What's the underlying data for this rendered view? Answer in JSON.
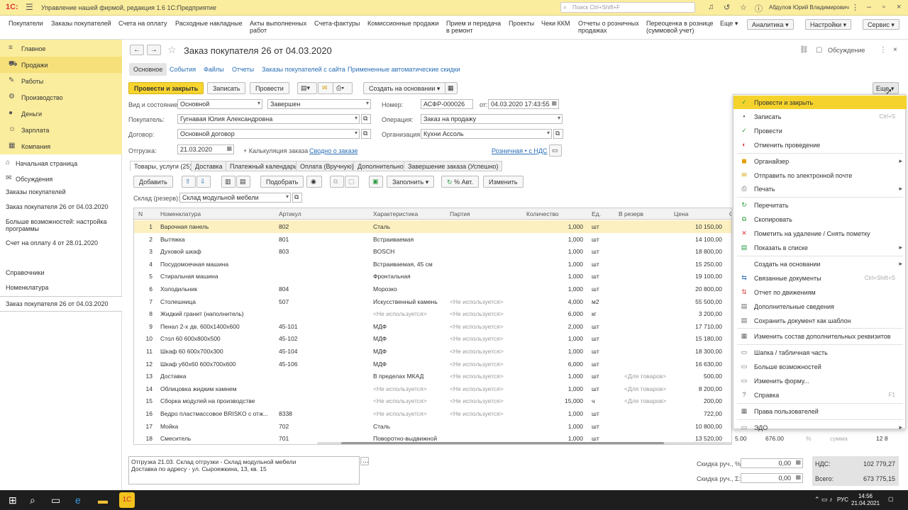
{
  "window": {
    "logo": "1С:",
    "title": "Управление нашей фирмой, редакция 1.6 1С:Предприятие",
    "search_placeholder": "Поиск Ctrl+Shift+F",
    "user": "Абдулов Юрий Владимирович"
  },
  "menubar": {
    "items": [
      "Покупатели",
      "Заказы покупателей",
      "Счета на оплату",
      "Расходные накладные",
      "Акты выполненных\nработ",
      "Счета-фактуры",
      "Комиссионные продажи",
      "Прием и передача\nв ремонт",
      "Проекты",
      "Чеки ККМ",
      "Отчеты о розничных\nпродажах",
      "Переоценка в рознице\n(суммовой учет)",
      "Еще"
    ],
    "buttons": [
      "Аналитика",
      "Настройки",
      "Сервис"
    ]
  },
  "sidebar": {
    "sections": [
      {
        "label": "Главное",
        "icon": "menu-icon"
      },
      {
        "label": "Продажи",
        "icon": "cart-icon"
      },
      {
        "label": "Работы",
        "icon": "wrench-icon"
      },
      {
        "label": "Производство",
        "icon": "factory-icon"
      },
      {
        "label": "Деньги",
        "icon": "coin-icon"
      },
      {
        "label": "Зарплата",
        "icon": "people-icon"
      },
      {
        "label": "Компания",
        "icon": "building-icon"
      }
    ],
    "nav": [
      {
        "label": "Начальная страница",
        "icon": "home-icon"
      },
      {
        "label": "Обсуждения",
        "icon": "chat-icon"
      }
    ],
    "history": [
      "Заказы покупателей",
      "Заказ покупателя 26 от 04.03.2020",
      "Больше возможностей: настройка программы",
      "Счет на оплату 4 от 28.01.2020",
      "Справочники",
      "Номенклатура",
      "Заказ покупателя 26 от 04.03.2020"
    ]
  },
  "doc": {
    "title": "Заказ покупателя 26 от 04.03.2020",
    "discussion": "Обсуждение",
    "tabs": [
      "Основное",
      "События",
      "Файлы",
      "Отчеты",
      "Заказы покупателей с сайта",
      "Примененные автоматические скидки"
    ],
    "toolbar": {
      "post_close": "Провести и закрыть",
      "save": "Записать",
      "post": "Провести",
      "create_based": "Создать на основании",
      "more": "Еще"
    },
    "fields": {
      "kind_label": "Вид и состояние:",
      "kind": "Основной",
      "state": "Завершен",
      "number_label": "Номер:",
      "number": "АСФР-000026",
      "from_label": "от:",
      "date": "04.03.2020 17:43:55",
      "buyer_label": "Покупатель:",
      "buyer": "Гугнавая Юлия Александровна",
      "operation_label": "Операция:",
      "operation": "Заказ на продажу",
      "contract_label": "Договор:",
      "contract": "Основной договор",
      "org_label": "Организация:",
      "org": "Кухни Ассоль",
      "ship_label": "Отгрузка:",
      "ship_date": "21.03.2020",
      "calc": "+ Калькуляция заказа",
      "summary": "Сводно о заказе",
      "price_type": "Розничная • с НДС"
    },
    "subtabs": [
      "Товары, услуги (25)",
      "Доставка",
      "Платежный календарь",
      "Оплата (Вручную)",
      "Дополнительно",
      "Завершение заказа (Успешно)"
    ],
    "tabletools": {
      "add": "Добавить",
      "pick": "Подобрать",
      "fill": "Заполнить",
      "auto": "% Авт.",
      "change": "Изменить"
    },
    "warehouse_label": "Склад (резерв):",
    "warehouse": "Склад модульной мебели",
    "columns": [
      "N",
      "Номенклатура",
      "Артикул",
      "Характеристика",
      "Партия",
      "Количество",
      "Ед.",
      "В резерв",
      "Цена",
      "С"
    ],
    "rows": [
      [
        "1",
        "Варочная панель",
        "802",
        "Сталь",
        "",
        "1,000",
        "шт",
        "",
        "10 150,00"
      ],
      [
        "2",
        "Вытяжка",
        "801",
        "Встраиваемая",
        "",
        "1,000",
        "шт",
        "",
        "14 100,00"
      ],
      [
        "3",
        "Духовой шкаф",
        "803",
        "BOSCH",
        "",
        "1,000",
        "шт",
        "",
        "18 800,00"
      ],
      [
        "4",
        "Посудомоечная машина",
        "",
        "Встраиваемая, 45 см",
        "",
        "1,000",
        "шт",
        "",
        "15 250,00"
      ],
      [
        "5",
        "Стиральная машина",
        "",
        "Фронтальная",
        "",
        "1,000",
        "шт",
        "",
        "19 100,00"
      ],
      [
        "6",
        "Холодильник",
        "804",
        "Морозко",
        "",
        "1,000",
        "шт",
        "",
        "20 800,00"
      ],
      [
        "7",
        "Столешница",
        "507",
        "Искусственный камень",
        "<Не используется>",
        "4,000",
        "м2",
        "",
        "55 500,00"
      ],
      [
        "8",
        "Жидкий гранит (наполнитель)",
        "",
        "<Не используется>",
        "<Не используется>",
        "6,000",
        "кг",
        "",
        "3 200,00"
      ],
      [
        "9",
        "Пенал 2-х дв. 600х1400х600",
        "45-101",
        "МДФ",
        "<Не используется>",
        "2,000",
        "шт",
        "",
        "17 710,00"
      ],
      [
        "10",
        "Стол 60 600х800х500",
        "45-102",
        "МДФ",
        "<Не используется>",
        "1,000",
        "шт",
        "",
        "15 180,00"
      ],
      [
        "11",
        "Шкаф 60 600х700х300",
        "45-104",
        "МДФ",
        "<Не используется>",
        "1,000",
        "шт",
        "",
        "18 300,00"
      ],
      [
        "12",
        "Шкаф у60х60 600х700х600",
        "45-106",
        "МДФ",
        "<Не используется>",
        "6,000",
        "шт",
        "",
        "16 630,00"
      ],
      [
        "13",
        "Доставка",
        "",
        "В пределах МКАД",
        "<Не используется>",
        "1,000",
        "шт",
        "<Для товаров>",
        "500,00"
      ],
      [
        "14",
        "Облицовка жидким камнем",
        "",
        "<Не используется>",
        "<Не используется>",
        "1,000",
        "шт",
        "<Для товаров>",
        "8 200,00"
      ],
      [
        "15",
        "Сборка модулей на производстве",
        "",
        "<Не используется>",
        "<Не используется>",
        "15,000",
        "ч",
        "<Для товаров>",
        "200,00"
      ],
      [
        "16",
        "Ведро пластмассовое BRISKO с отж...",
        "8338",
        "<Не используется>",
        "<Не используется>",
        "1,000",
        "шт",
        "",
        "722,00"
      ],
      [
        "17",
        "Мойка",
        "702",
        "Сталь",
        "",
        "1,000",
        "шт",
        "",
        "10 800,00"
      ],
      [
        "18",
        "Смеситель",
        "701",
        "Поворотно-выдвижной",
        "",
        "1,000",
        "шт",
        "",
        "13 520,00"
      ]
    ],
    "row18_extra": {
      "a": "5.00",
      "b": "676.00",
      "c": "%",
      "d": "сумма",
      "e": "12 8"
    },
    "note": "Отгрузка 21.03. Склад отгрузки - Склад модульной мебели\nДоставка по адресу - ул. Сыроежкина, 13, кв. 15",
    "footer": {
      "disc_pct_label": "Скидка руч., %:",
      "disc_pct": "0,00",
      "disc_sum_label": "Скидка руч., Σ:",
      "disc_sum": "0,00",
      "vat_label": "НДС:",
      "vat": "102 779,27",
      "total_label": "Всего:",
      "total": "673 775,15"
    }
  },
  "dropdown": [
    {
      "label": "Провести и закрыть",
      "icon": "post-close-icon",
      "shortcut": "",
      "arrow": false,
      "selected": true
    },
    {
      "label": "Записать",
      "icon": "save-icon",
      "shortcut": "Ctrl+S",
      "arrow": false
    },
    {
      "label": "Провести",
      "icon": "post-icon",
      "shortcut": "",
      "arrow": false
    },
    {
      "label": "Отменить проведение",
      "icon": "unpost-icon",
      "shortcut": "",
      "arrow": false
    },
    {
      "sep": true
    },
    {
      "label": "Органайзер",
      "icon": "organizer-icon",
      "shortcut": "",
      "arrow": true
    },
    {
      "label": "Отправить по электронной почте",
      "icon": "mail-icon",
      "shortcut": "",
      "arrow": false
    },
    {
      "label": "Печать",
      "icon": "print-icon",
      "shortcut": "",
      "arrow": true
    },
    {
      "sep": true
    },
    {
      "label": "Перечитать",
      "icon": "refresh-icon",
      "shortcut": "",
      "arrow": false
    },
    {
      "label": "Скопировать",
      "icon": "copy-icon",
      "shortcut": "",
      "arrow": false
    },
    {
      "label": "Пометить на удаление / Снять пометку",
      "icon": "delete-mark-icon",
      "shortcut": "",
      "arrow": false
    },
    {
      "label": "Показать в списке",
      "icon": "list-icon",
      "shortcut": "",
      "arrow": true
    },
    {
      "sep": true
    },
    {
      "label": "Создать на основании",
      "icon": "",
      "shortcut": "",
      "arrow": true
    },
    {
      "label": "Связанные документы",
      "icon": "linked-docs-icon",
      "shortcut": "Ctrl+Shift+S",
      "arrow": false
    },
    {
      "label": "Отчет по движениям",
      "icon": "report-icon",
      "shortcut": "",
      "arrow": false
    },
    {
      "label": "Дополнительные сведения",
      "icon": "info-icon",
      "shortcut": "",
      "arrow": false
    },
    {
      "label": "Сохранить документ как шаблон",
      "icon": "template-icon",
      "shortcut": "",
      "arrow": false
    },
    {
      "sep": true
    },
    {
      "label": "Изменить состав дополнительных реквизитов",
      "icon": "attrs-icon",
      "shortcut": "",
      "arrow": false
    },
    {
      "sep": true
    },
    {
      "label": "Шапка / табличная часть",
      "icon": "layout-icon",
      "shortcut": "",
      "arrow": false
    },
    {
      "label": "Больше возможностей",
      "icon": "more-icon",
      "shortcut": "",
      "arrow": false
    },
    {
      "label": "Изменить форму...",
      "icon": "form-icon",
      "shortcut": "",
      "arrow": false
    },
    {
      "label": "Справка",
      "icon": "help-icon",
      "shortcut": "F1",
      "arrow": false
    },
    {
      "sep": true
    },
    {
      "label": "Права пользователей",
      "icon": "rights-icon",
      "shortcut": "",
      "arrow": false
    },
    {
      "sep": true
    },
    {
      "label": "ЭДО",
      "icon": "edo-icon",
      "shortcut": "",
      "arrow": true
    }
  ],
  "taskbar": {
    "lang": "РУС",
    "time": "14:56",
    "date": "21.04.2021"
  }
}
